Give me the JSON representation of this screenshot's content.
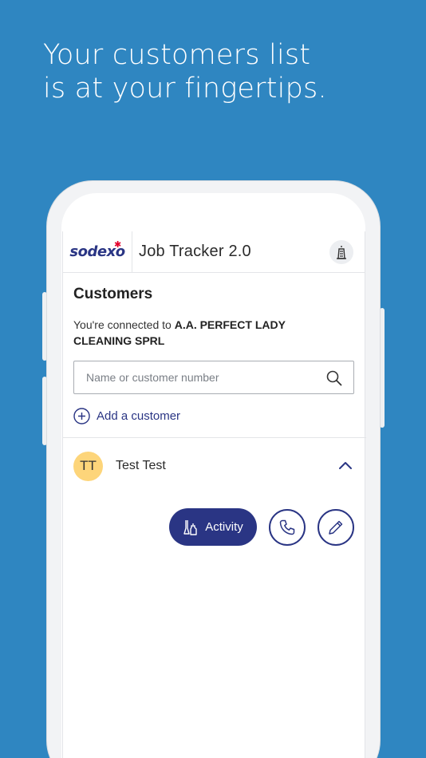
{
  "headline": {
    "line1": "Your customers list",
    "line2": "is at your fingertips."
  },
  "app": {
    "logo_text": "sodexo",
    "title": "Job Tracker 2.0"
  },
  "customers": {
    "title": "Customers",
    "connected_prefix": "You're connected to ",
    "company": "A.A. PERFECT LADY CLEANING SPRL",
    "search_placeholder": "Name or customer number",
    "add_label": "Add a customer"
  },
  "customer_list": [
    {
      "initials": "TT",
      "name": "Test Test",
      "expanded": true
    }
  ],
  "actions": {
    "activity_label": "Activity"
  },
  "colors": {
    "background": "#2f86c1",
    "brand_navy": "#2a3584",
    "avatar_yellow": "#fdd57a"
  }
}
